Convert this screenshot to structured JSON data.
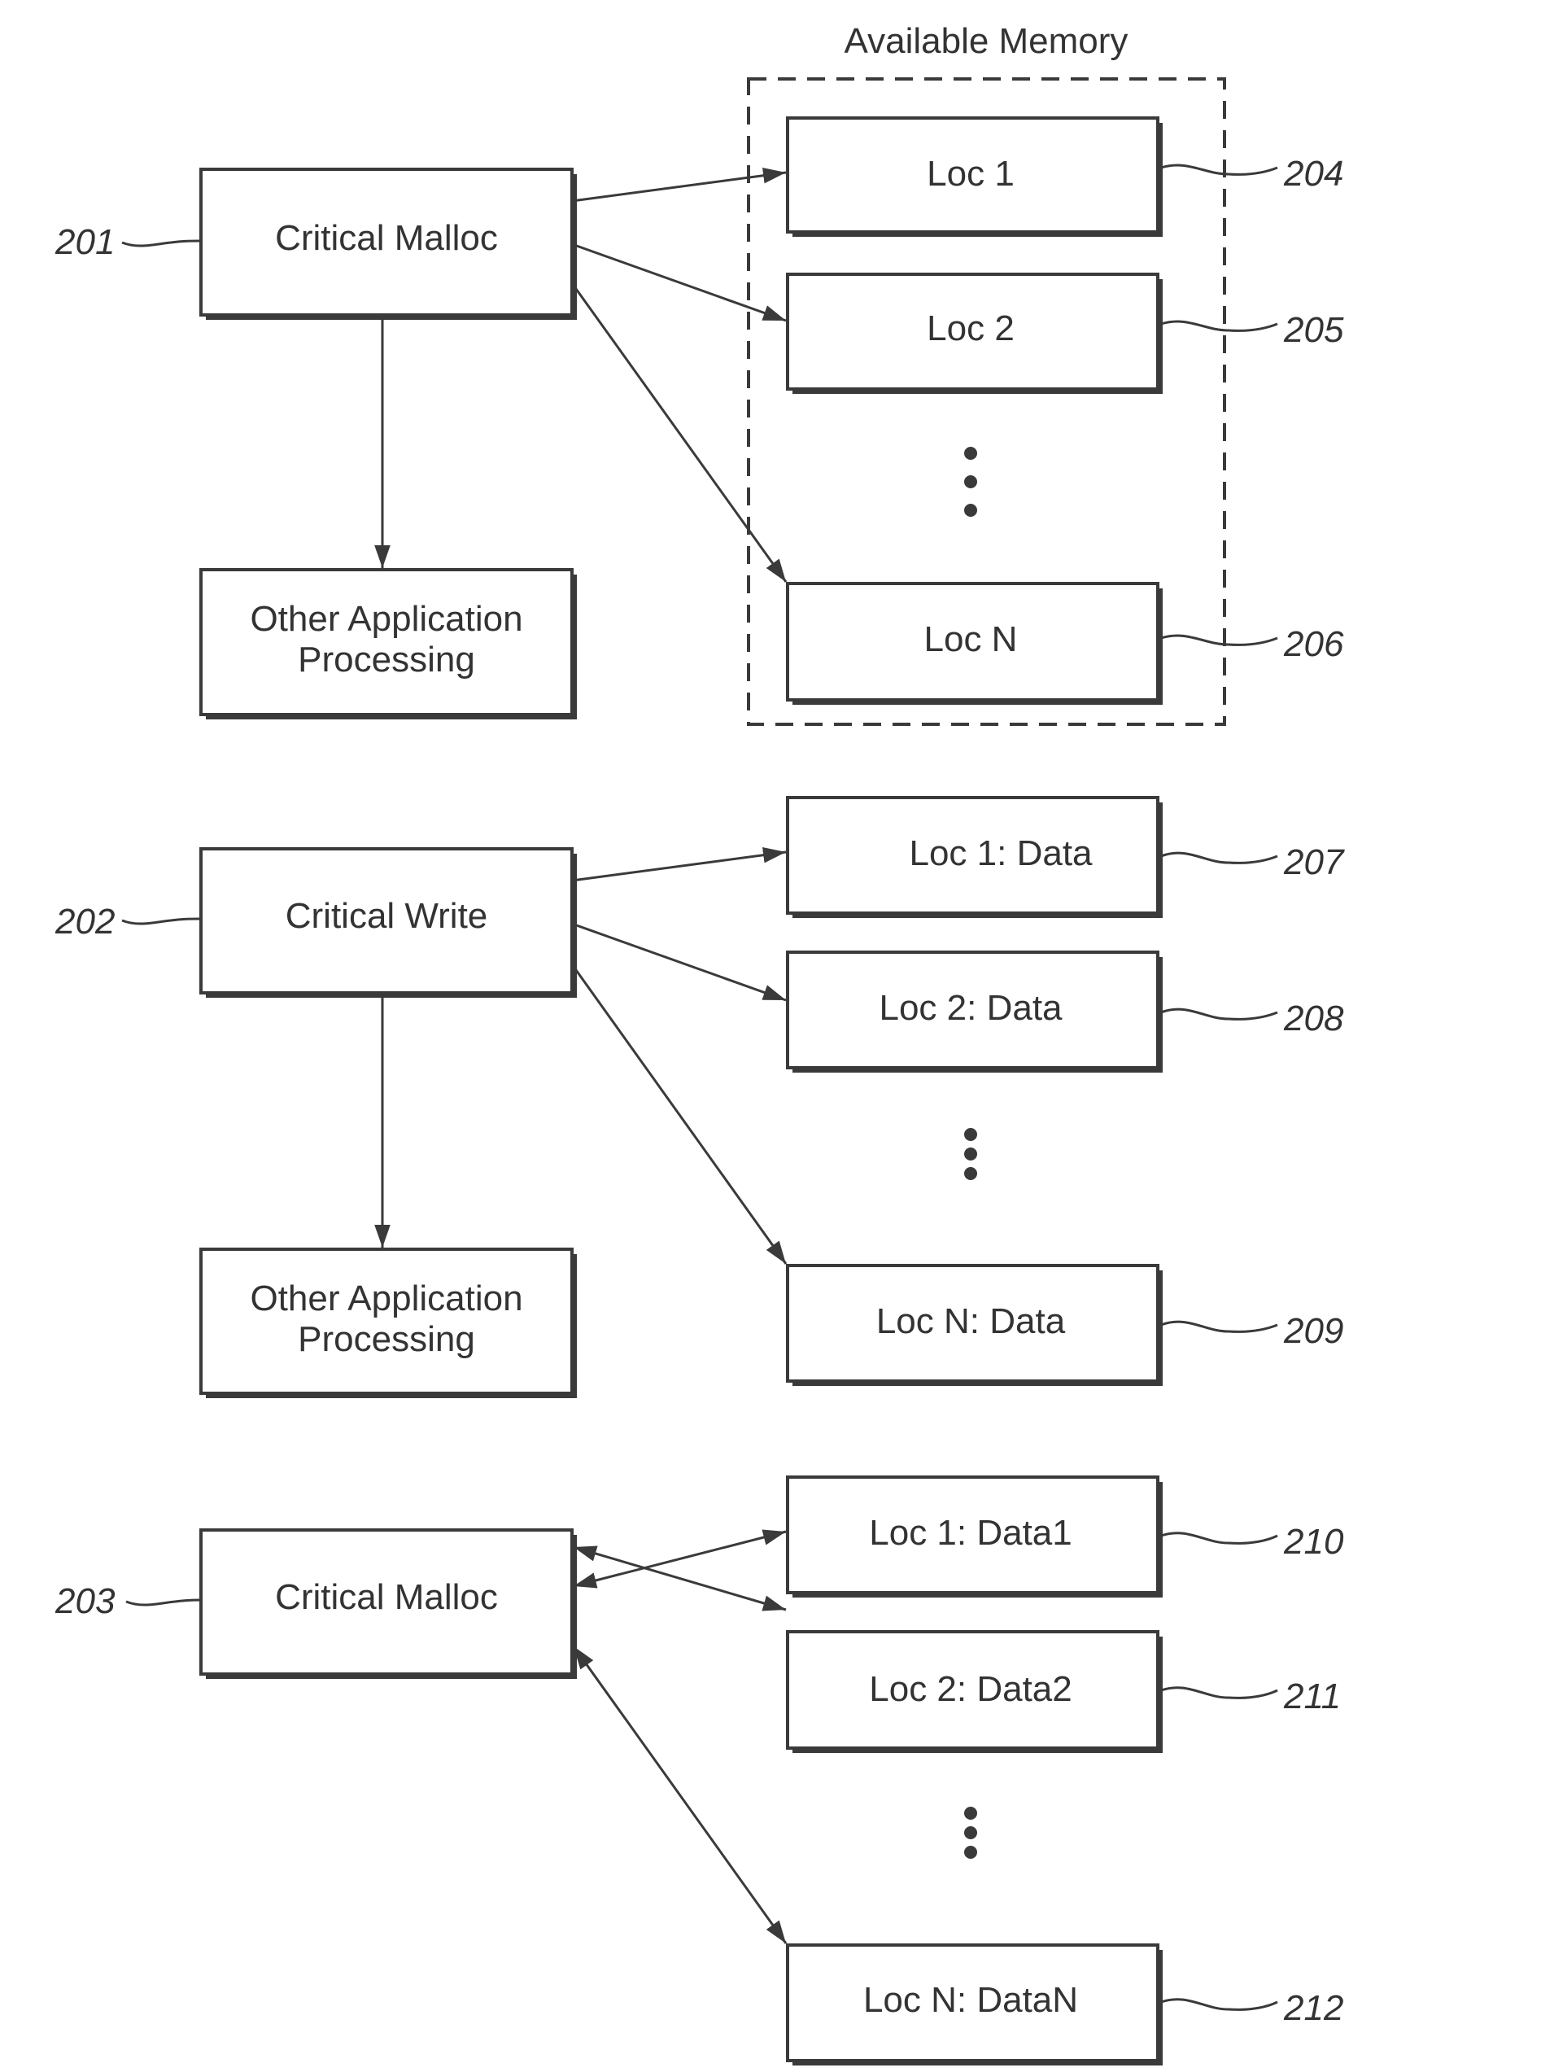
{
  "figure": {
    "container_title": "Available Memory",
    "colors": {
      "stroke": "#3a3a3a",
      "text": "#333333",
      "background": "#ffffff"
    }
  },
  "groups": [
    {
      "ref": "201",
      "source_label": "Critical Malloc",
      "other_label_line1": "Other Application",
      "other_label_line2": "Processing",
      "arrow_style": "unidirectional",
      "targets": [
        {
          "label": "Loc 1",
          "ref": "204"
        },
        {
          "label": "Loc 2",
          "ref": "205"
        },
        {
          "label": "Loc N",
          "ref": "206"
        }
      ]
    },
    {
      "ref": "202",
      "source_label": "Critical Write",
      "other_label_line1": "Other Application",
      "other_label_line2": "Processing",
      "arrow_style": "unidirectional",
      "targets": [
        {
          "label": "Loc 1: Data",
          "ref": "207"
        },
        {
          "label": "Loc 2: Data",
          "ref": "208"
        },
        {
          "label": "Loc N: Data",
          "ref": "209"
        }
      ]
    },
    {
      "ref": "203",
      "source_label": "Critical Malloc",
      "arrow_style": "bidirectional",
      "targets": [
        {
          "label": "Loc 1: Data1",
          "ref": "210"
        },
        {
          "label": "Loc 2: Data2",
          "ref": "211"
        },
        {
          "label": "Loc N: DataN",
          "ref": "212"
        }
      ]
    }
  ]
}
